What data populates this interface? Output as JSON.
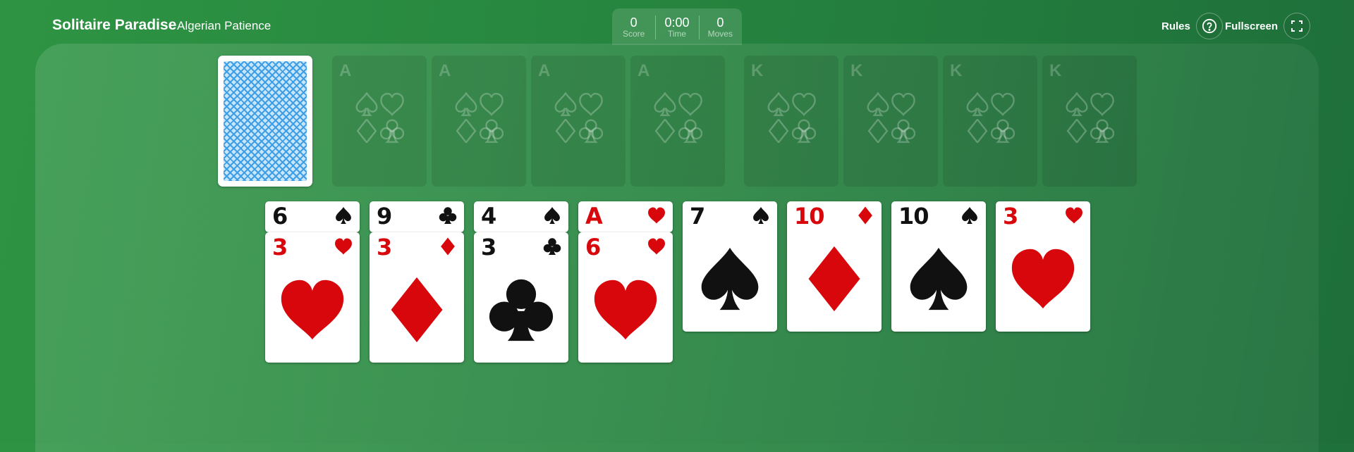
{
  "header": {
    "app_title": "Solitaire Paradise",
    "game_name": "Algerian Patience",
    "stats": [
      {
        "value": "0",
        "label": "Score"
      },
      {
        "value": "0:00",
        "label": "Time"
      },
      {
        "value": "0",
        "label": "Moves"
      }
    ],
    "rules_label": "Rules",
    "fullscreen_label": "Fullscreen"
  },
  "foundations": [
    {
      "rank": "A"
    },
    {
      "rank": "A"
    },
    {
      "rank": "A"
    },
    {
      "rank": "A"
    },
    {
      "rank": "K"
    },
    {
      "rank": "K"
    },
    {
      "rank": "K"
    },
    {
      "rank": "K"
    }
  ],
  "tableau": [
    {
      "cards": [
        {
          "rank": "6",
          "suit": "spades"
        },
        {
          "rank": "3",
          "suit": "hearts"
        }
      ]
    },
    {
      "cards": [
        {
          "rank": "9",
          "suit": "clubs"
        },
        {
          "rank": "3",
          "suit": "diamonds"
        }
      ]
    },
    {
      "cards": [
        {
          "rank": "4",
          "suit": "spades"
        },
        {
          "rank": "3",
          "suit": "clubs"
        }
      ]
    },
    {
      "cards": [
        {
          "rank": "A",
          "suit": "hearts"
        },
        {
          "rank": "6",
          "suit": "hearts"
        }
      ]
    },
    {
      "cards": [
        {
          "rank": "7",
          "suit": "spades"
        }
      ]
    },
    {
      "cards": [
        {
          "rank": "10",
          "suit": "diamonds"
        }
      ]
    },
    {
      "cards": [
        {
          "rank": "10",
          "suit": "spades"
        }
      ]
    },
    {
      "cards": [
        {
          "rank": "3",
          "suit": "hearts"
        }
      ]
    }
  ],
  "colors": {
    "felt": "#26853f",
    "red_suit": "#d7070c",
    "black_suit": "#111111",
    "card_back": "#3d9ee6"
  }
}
